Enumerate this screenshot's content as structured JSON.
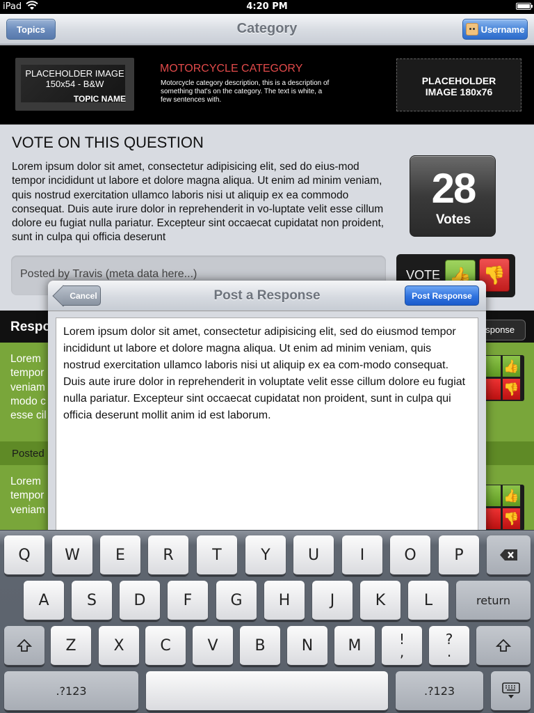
{
  "status_bar": {
    "carrier": "iPad",
    "time": "4:20 PM"
  },
  "nav": {
    "title": "Category",
    "left_button": "Topics",
    "right_button": "Username"
  },
  "category": {
    "placeholder_left_line1": "PLACEHOLDER IMAGE",
    "placeholder_left_line2": "150x54  -  B&W",
    "topic_name": "TOPIC NAME",
    "title": "MOTORCYCLE CATEGORY",
    "description": "Motorcycle category description, this is a description of something that's on the category. The text is white, a few sentences with.",
    "placeholder_right_line1": "PLACEHOLDER",
    "placeholder_right_line2": "IMAGE 180x76"
  },
  "question": {
    "heading": "VOTE ON THIS QUESTION",
    "body": "Lorem ipsum dolor sit amet, consectetur adipisicing elit, sed do eius-mod tempor incididunt ut labore et dolore magna aliqua. Ut enim ad minim veniam, quis nostrud exercitation ullamco laboris nisi ut aliquip ex ea commodo consequat. Duis aute irure dolor in reprehenderit in vo-luptate velit esse cillum dolore eu fugiat nulla pariatur. Excepteur sint occaecat cupidatat non proident, sunt in culpa qui officia deserunt",
    "vote_count": "28",
    "vote_label": "Votes",
    "posted_by": "Posted by Travis (meta data here...)",
    "vote_control_label": "VOTE"
  },
  "responses": {
    "header_label": "Respo",
    "button_label": "esponse",
    "item1_text": "Lorem tempor veniam modo c esse cil",
    "item1_meta": "Posted",
    "item2_text": "Lorem tempor veniam"
  },
  "modal": {
    "title": "Post a Response",
    "cancel_label": "Cancel",
    "post_label": "Post Response",
    "text_value": "Lorem ipsum dolor sit amet, consectetur adipisicing elit, sed do eiusmod tempor incididunt ut labore et dolore magna aliqua. Ut enim ad minim veniam, quis nostrud exercitation ullamco laboris nisi ut aliquip ex ea com-modo consequat. Duis aute irure dolor in reprehenderit in voluptate velit esse cillum dolore eu fugiat nulla pariatur. Excepteur sint occaecat cupidatat non proident, sunt in culpa qui officia deserunt mollit anim id est laborum."
  },
  "keyboard": {
    "row1": [
      "Q",
      "W",
      "E",
      "R",
      "T",
      "Y",
      "U",
      "I",
      "O",
      "P"
    ],
    "row2": [
      "A",
      "S",
      "D",
      "F",
      "G",
      "H",
      "J",
      "K",
      "L"
    ],
    "row3": [
      "Z",
      "X",
      "C",
      "V",
      "B",
      "N",
      "M"
    ],
    "return_label": "return",
    "numbers_label": ".?123",
    "punct1_top": "!",
    "punct1_bottom": ",",
    "punct2_top": "?",
    "punct2_bottom": "."
  },
  "icons": {
    "wifi": "wifi-icon",
    "battery": "battery-icon",
    "thumbs_up": "thumbs-up-icon",
    "thumbs_down": "thumbs-down-icon",
    "delete": "delete-icon",
    "shift": "shift-icon",
    "hide_keyboard": "hide-keyboard-icon"
  },
  "colors": {
    "category_title": "#e14a4a",
    "response_green": "#79a63a",
    "post_button_blue": "#2f72de"
  }
}
